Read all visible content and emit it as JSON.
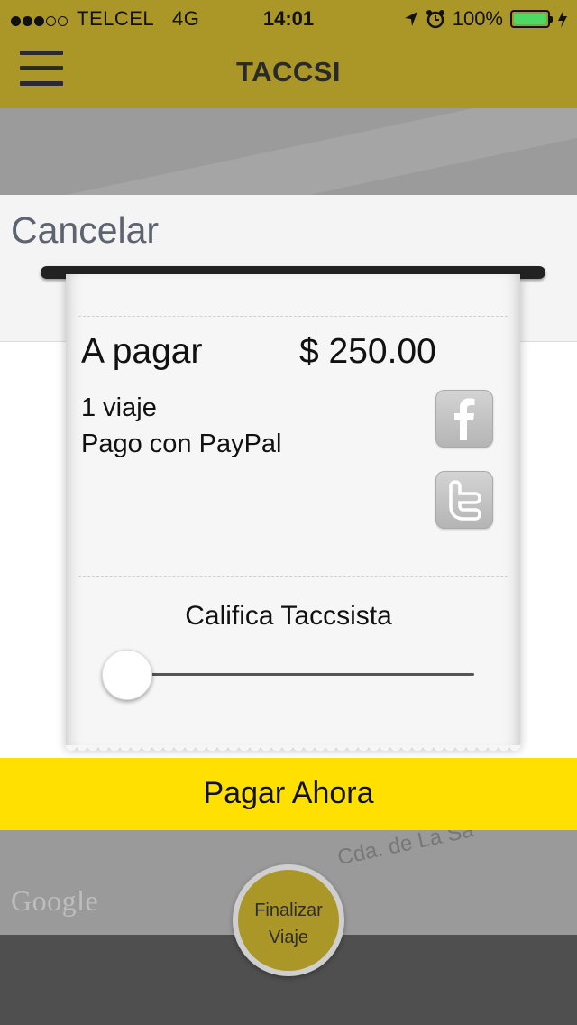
{
  "status_bar": {
    "carrier": "TELCEL",
    "network": "4G",
    "time": "14:01",
    "battery": "100%",
    "battery_level": 1.0,
    "signal_bars_filled": 3,
    "signal_bars_total": 5,
    "icons": [
      "location-arrow-icon",
      "alarm-clock-icon",
      "battery-icon",
      "charging-bolt-icon"
    ]
  },
  "header": {
    "title": "TACCSI",
    "menu_icon": "hamburger-menu-icon",
    "background_color": "#ab9728"
  },
  "dialog": {
    "cancel_label": "Cancelar"
  },
  "receipt": {
    "label_pay": "A pagar",
    "amount": "$ 250.00",
    "trips": "1 viaje",
    "payment_method": "Pago con PayPal",
    "social": [
      "facebook-icon",
      "twitter-icon"
    ],
    "rating_label": "Califica Taccsista",
    "rating_value": 0
  },
  "pay_button": {
    "label": "Pagar Ahora",
    "color": "#ffe000"
  },
  "map": {
    "road_label": "Cda. de La Sa",
    "attribution": "Google"
  },
  "finalize_button": {
    "line1": "Finalizar",
    "line2": "Viaje"
  }
}
